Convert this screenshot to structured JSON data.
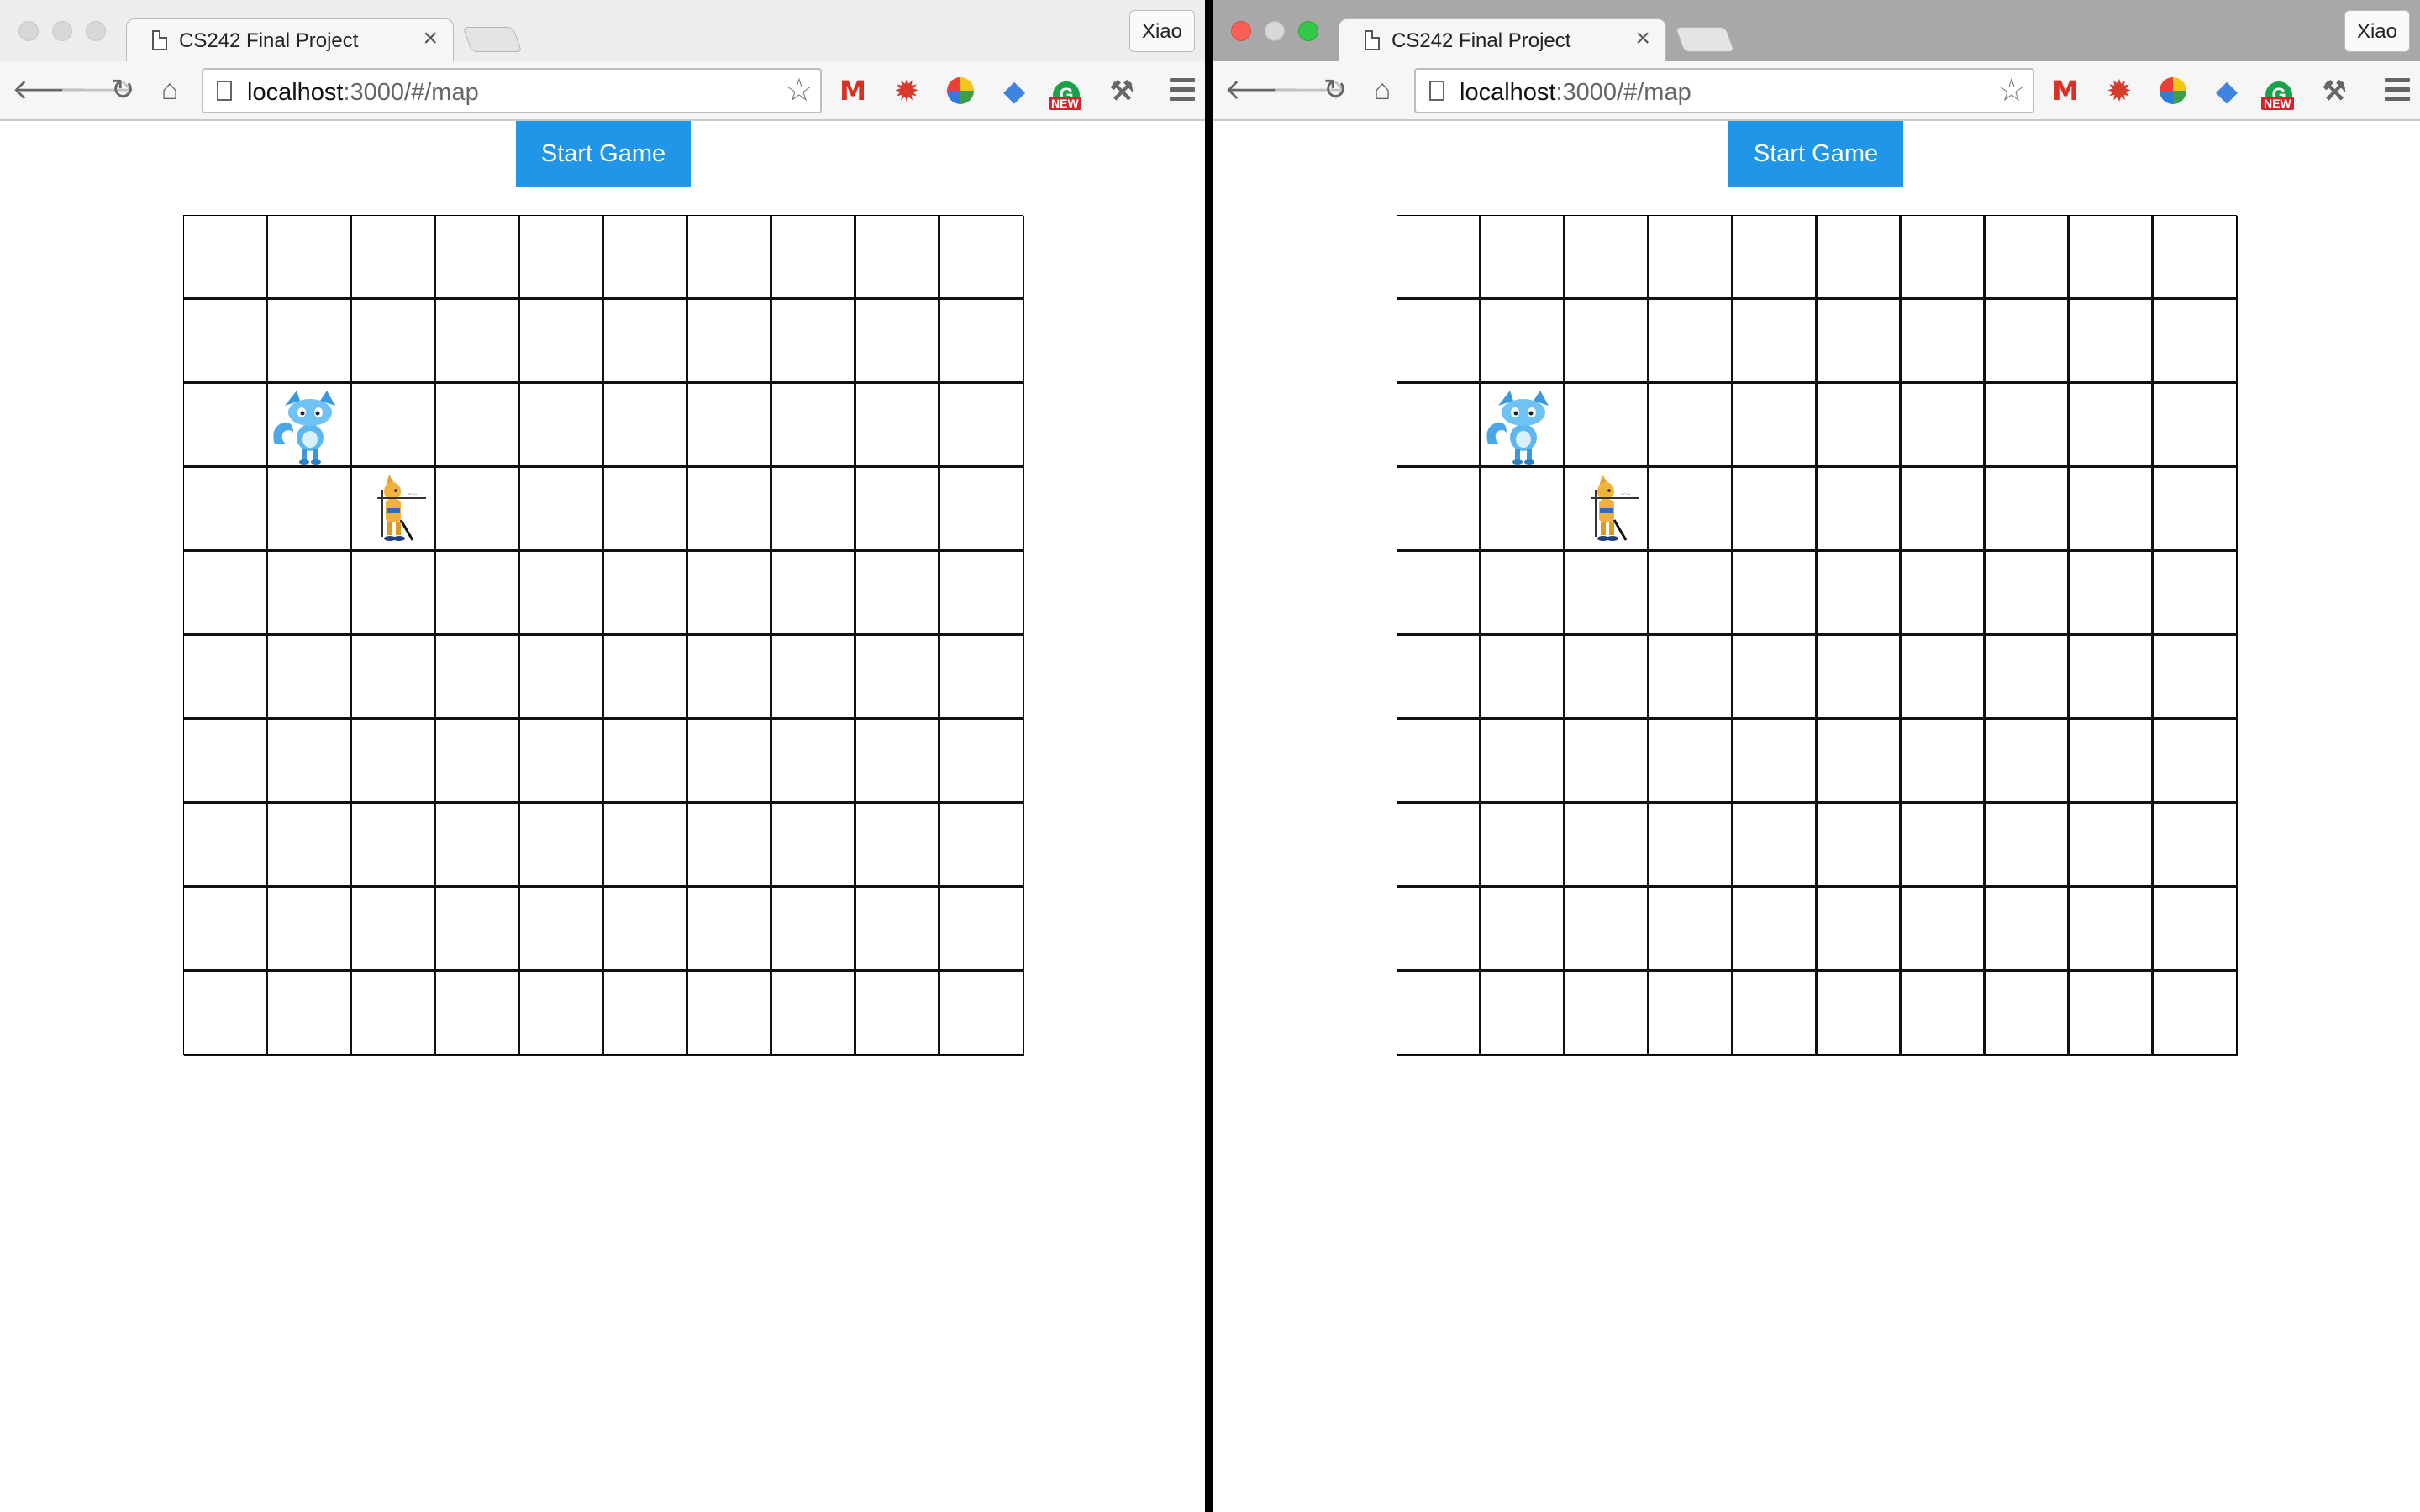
{
  "windows": [
    {
      "id": "left",
      "active": false,
      "tab": {
        "title": "CS242 Final Project",
        "close": "×"
      },
      "profile": "Xiao",
      "address": {
        "host": "localhost",
        "rest": ":3000/#/map"
      },
      "extensions": [
        "gmail-icon",
        "burst-icon",
        "checkmark-disc-icon",
        "graduation-cap-icon",
        "grammarly-icon",
        "tool-icon"
      ],
      "extension_badge": "NEW",
      "start_button": "Start Game",
      "grid": {
        "rows": 10,
        "cols": 10
      },
      "pieces": [
        {
          "name": "blue-fox-character",
          "row": 3,
          "col": 2
        },
        {
          "name": "orange-fox-swordsman-character",
          "row": 4,
          "col": 3
        }
      ]
    },
    {
      "id": "right",
      "active": true,
      "tab": {
        "title": "CS242 Final Project",
        "close": "×"
      },
      "profile": "Xiao",
      "address": {
        "host": "localhost",
        "rest": ":3000/#/map"
      },
      "extensions": [
        "gmail-icon",
        "burst-icon",
        "checkmark-disc-icon",
        "graduation-cap-icon",
        "grammarly-icon",
        "tool-icon"
      ],
      "extension_badge": "NEW",
      "start_button": "Start Game",
      "grid": {
        "rows": 10,
        "cols": 10
      },
      "pieces": [
        {
          "name": "blue-fox-character",
          "row": 3,
          "col": 2
        },
        {
          "name": "orange-fox-swordsman-character",
          "row": 4,
          "col": 3
        }
      ]
    }
  ],
  "colors": {
    "start_button": "#2196e8",
    "grid_line": "#111111",
    "divider": "#000000"
  }
}
